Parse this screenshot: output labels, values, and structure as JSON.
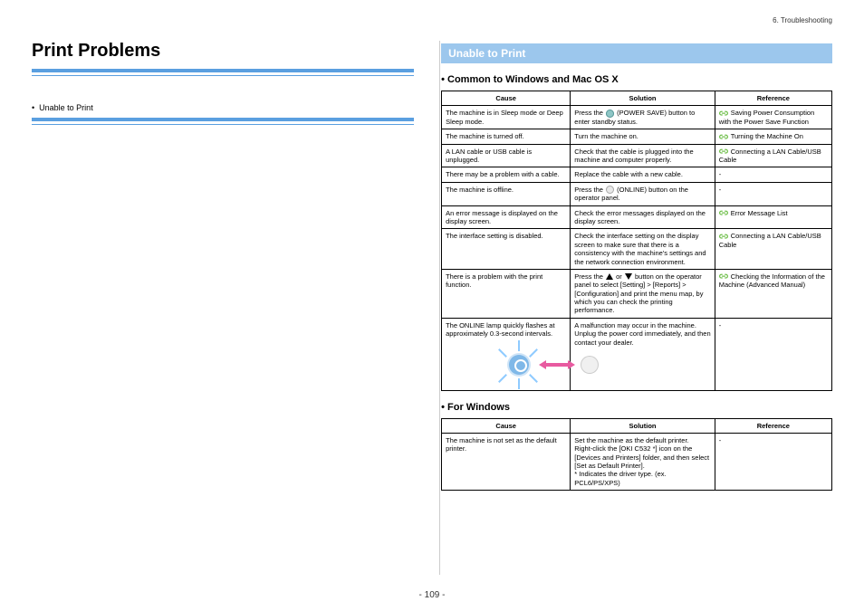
{
  "breadcrumb": "6. Troubleshooting",
  "page_title": "Print Problems",
  "toc": {
    "item1": "Unable to Print"
  },
  "section_heading": "Unable to Print",
  "subheading_common": "Common to Windows and Mac OS X",
  "subheading_windows": "For Windows",
  "table_headers": {
    "cause": "Cause",
    "solution": "Solution",
    "reference": "Reference"
  },
  "common_rows": [
    {
      "cause": "The machine is in Sleep mode or Deep Sleep mode.",
      "solution_pre": "Press the ",
      "solution_post": " (POWER SAVE) button to enter standby status.",
      "icon": "power-save",
      "reference": "Saving Power Consumption with the Power Save Function",
      "link": true
    },
    {
      "cause": "The machine is turned off.",
      "solution": "Turn the machine on.",
      "reference": "Turning the Machine On",
      "link": true
    },
    {
      "cause": "A LAN cable or USB cable is unplugged.",
      "solution": "Check that the cable is plugged into the machine and computer properly.",
      "reference": "Connecting a LAN Cable/USB Cable",
      "link": true
    },
    {
      "cause": "There may be a problem with a cable.",
      "solution": "Replace the cable with a new cable.",
      "reference": "-",
      "link": false
    },
    {
      "cause": "The machine is offline.",
      "solution_pre": "Press the ",
      "solution_post": " (ONLINE) button on the operator panel.",
      "icon": "online",
      "reference": "-",
      "link": false
    },
    {
      "cause": "An error message is displayed on the display screen.",
      "solution": "Check the error messages displayed on the display screen.",
      "reference": "Error Message List",
      "link": true
    },
    {
      "cause": "The interface setting is disabled.",
      "solution": "Check the interface setting on the display screen to make sure that there is a consistency with the machine's settings and the network connection environment.",
      "reference": "Connecting a LAN Cable/USB Cable",
      "link": true
    },
    {
      "cause": "There is a problem with the print function.",
      "solution_pre": "Press the ",
      "solution_mid": " or ",
      "solution_post": " button on the operator panel to select [Setting] > [Reports] > [Configuration] and print the menu map, by which you can check the printing performance.",
      "icon": "arrows",
      "reference": "Checking the Information of the Machine (Advanced Manual)",
      "link": true
    },
    {
      "cause": "The ONLINE lamp quickly flashes at approximately 0.3-second intervals.",
      "solution": "A malfunction may occur in the machine. Unplug the power cord immediately, and then contact your dealer.",
      "reference": "-",
      "link": false,
      "diagram": true
    }
  ],
  "windows_rows": [
    {
      "cause": "The machine is not set as the default printer.",
      "solution": "Set the machine as the default printer.\nRight-click the [OKI C532 *] icon on the [Devices and Printers] folder, and then select [Set as Default Printer].\n* Indicates the driver type. (ex. PCL6/PS/XPS)",
      "reference": "-",
      "link": false
    }
  ],
  "page_number": "- 109 -"
}
